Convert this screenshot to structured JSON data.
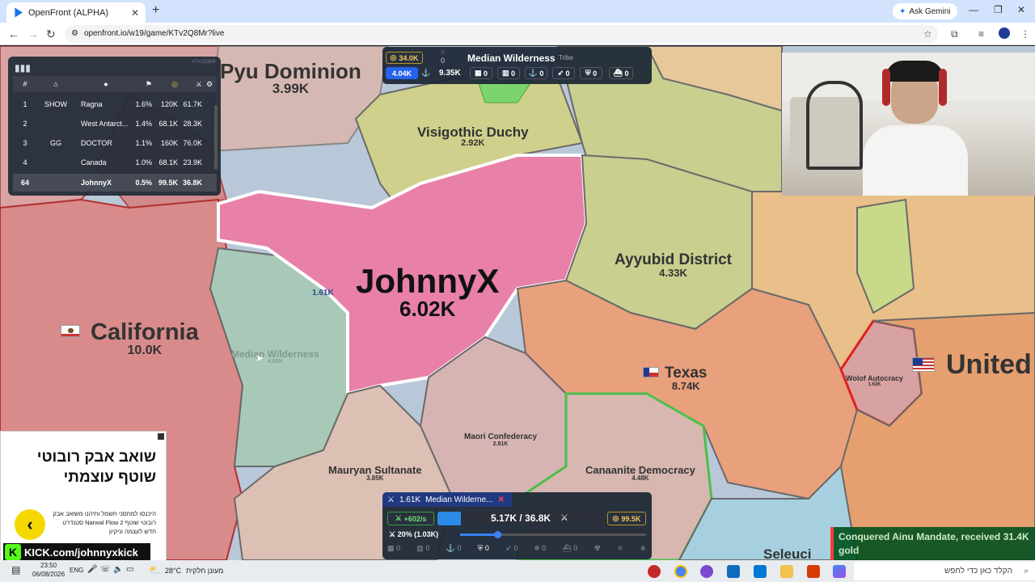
{
  "browser": {
    "tab_title": "OpenFront (ALPHA)",
    "tab_close": "✕",
    "new_tab": "+",
    "ask_gemini": "Ask Gemini",
    "url": "openfront.io/w19/game/KTv2Q8Mr?live",
    "min": "—",
    "max": "❐",
    "close": "✕"
  },
  "map": {
    "regions": [
      {
        "name": "Pyu Dominion",
        "value": "3.99K"
      },
      {
        "name": "Visigothic Duchy",
        "value": "2.92K"
      },
      {
        "name": "JohnnyX",
        "value": "6.02K"
      },
      {
        "name": "Ayyubid District",
        "value": "4.33K"
      },
      {
        "name": "California",
        "value": "10.0K"
      },
      {
        "name": "Median Wilderness",
        "value": "4.05K"
      },
      {
        "name": "Texas",
        "value": "8.74K"
      },
      {
        "name": "United",
        "value": ""
      },
      {
        "name": "Wolof Autocracy",
        "value": "1.62K"
      },
      {
        "name": "Maori Confederacy",
        "value": "2.81K"
      },
      {
        "name": "Mauryan Sultanate",
        "value": "3.85K"
      },
      {
        "name": "Canaanite Democracy",
        "value": "4.48K"
      },
      {
        "name": "Seleuci",
        "value": ""
      }
    ],
    "troop_marker": "1.61K"
  },
  "leaderboard": {
    "watermark": "KTv2Q8Mr",
    "headers": [
      "#",
      "",
      "",
      "",
      "",
      "",
      ""
    ],
    "rows": [
      {
        "rank": "1",
        "clan": "SHOW",
        "name": "Ragna",
        "pct": "1.6%",
        "gold": "120K",
        "troops": "61.7K"
      },
      {
        "rank": "2",
        "clan": "",
        "name": "West Antarct...",
        "pct": "1.4%",
        "gold": "68.1K",
        "troops": "28.3K"
      },
      {
        "rank": "3",
        "clan": "GG",
        "name": "DOCTOR",
        "pct": "1.1%",
        "gold": "160K",
        "troops": "76.0K"
      },
      {
        "rank": "4",
        "clan": "",
        "name": "Canada",
        "pct": "1.0%",
        "gold": "68.1K",
        "troops": "23.9K"
      },
      {
        "rank": "64",
        "clan": "",
        "name": "JohnnyX",
        "pct": "0.5%",
        "gold": "99.5K",
        "troops": "36.8K"
      }
    ]
  },
  "info_panel": {
    "gold": "34.0K",
    "top_count": "0",
    "title": "Median Wilderness",
    "subtitle": "Tribe",
    "troops": "4.04K",
    "boats": "9.35K",
    "counts": [
      "0",
      "0",
      "0",
      "0",
      "0",
      "0"
    ]
  },
  "ad": {
    "headline_1": "שואב אבק רובוטי",
    "headline_2": "שוטף עוצמתי",
    "body": "היכנסו למחסני חשמל ותיהנו משואב אבק רובוטי שוטף Narwal Flow 2 סטנדרט חדש לעצמה וניקיון",
    "arrow": "‹",
    "kick_text": "KICK.com/johnnyxkick",
    "kick_logo": "K"
  },
  "control": {
    "attack_troops": "1.61K",
    "attack_target": "Median Wilderne...",
    "rate": "+602/s",
    "troops_ratio": "5.17K / 36.8K",
    "gold": "99.5K",
    "attack_pct": "20% (1.03K)",
    "attack_slider": 0.2,
    "troop_fill": 0.14,
    "counts": [
      "0",
      "0",
      "0",
      "0",
      "0",
      "0",
      "0"
    ]
  },
  "notification": {
    "text": "Conquered Ainu Mandate, received 31.4K gold"
  },
  "taskbar": {
    "time": "23:50",
    "date": "06/08/2026",
    "lang": "ENG",
    "weather_temp": "28°C",
    "weather_desc": "מעונן חלקית",
    "search": "הקלד כאן כדי לחפש"
  },
  "colors": {
    "johnnyx": "#e880a8",
    "california": "#d98a8a",
    "median": "#a9c9b8",
    "texas": "#e9a07d",
    "ayyubid": "#c9cf8f",
    "visigothic": "#cfd08c",
    "panel": "#1f2937"
  }
}
